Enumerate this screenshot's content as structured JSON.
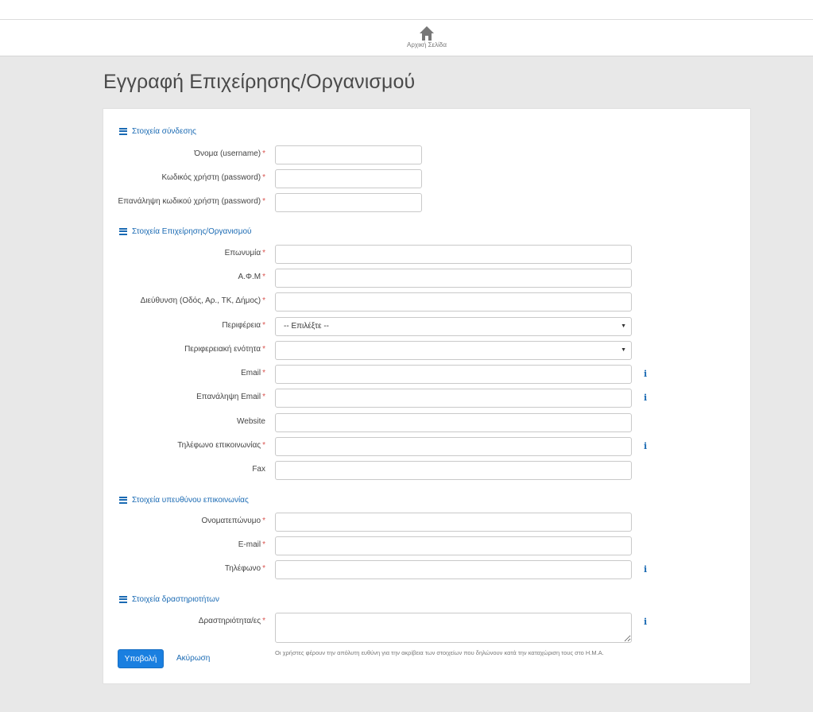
{
  "nav": {
    "home_label": "Αρχική Σελίδα",
    "home_icon": "home-icon"
  },
  "page": {
    "title": "Εγγραφή Επιχείρησης/Οργανισμού"
  },
  "sections": {
    "login": {
      "title": "Στοιχεία σύνδεσης"
    },
    "business": {
      "title": "Στοιχεία Επιχείρησης/Οργανισμού"
    },
    "contact": {
      "title": "Στοιχεία υπευθύνου επικοινωνίας"
    },
    "activities": {
      "title": "Στοιχεία δραστηριοτήτων"
    }
  },
  "fields": {
    "username": {
      "label": "Όνομα (username)",
      "required": "*",
      "value": ""
    },
    "password": {
      "label": "Κωδικός χρήστη (password)",
      "required": "*",
      "value": ""
    },
    "password_repeat": {
      "label": "Επανάληψη κωδικού χρήστη (password)",
      "required": "*",
      "value": ""
    },
    "company_name": {
      "label": "Επωνυμία",
      "required": "*",
      "value": ""
    },
    "afm": {
      "label": "Α.Φ.Μ",
      "required": "*",
      "value": ""
    },
    "address": {
      "label": "Διεύθυνση (Οδός, Αρ., ΤΚ, Δήμος)",
      "required": "*",
      "value": ""
    },
    "region": {
      "label": "Περιφέρεια",
      "required": "*",
      "selected": "-- Επιλέξτε --",
      "caret": "▼"
    },
    "regional_unit": {
      "label": "Περιφερειακή ενότητα",
      "required": "*",
      "selected": "",
      "caret": "▼"
    },
    "email": {
      "label": "Email",
      "required": "*",
      "value": "",
      "info": "i"
    },
    "email_repeat": {
      "label": "Επανάληψη Email",
      "required": "*",
      "value": "",
      "info": "i"
    },
    "website": {
      "label": "Website",
      "value": ""
    },
    "phone": {
      "label": "Τηλέφωνο επικοινωνίας",
      "required": "*",
      "value": "",
      "info": "i"
    },
    "fax": {
      "label": "Fax",
      "value": ""
    },
    "contact_name": {
      "label": "Ονοματεπώνυμο",
      "required": "*",
      "value": ""
    },
    "contact_email": {
      "label": "E-mail",
      "required": "*",
      "value": ""
    },
    "contact_phone": {
      "label": "Τηλέφωνο",
      "required": "*",
      "value": "",
      "info": "i"
    },
    "activities": {
      "label": "Δραστηριότητα/ες",
      "required": "*",
      "value": "",
      "info": "i"
    }
  },
  "actions": {
    "submit_label": "Υποβολή",
    "cancel_label": "Ακύρωση",
    "disclaimer": "Οι χρήστες φέρουν την απόλυτη ευθύνη για την ακρίβεια των στοιχείων που δηλώνουν κατά την καταχώριση τους στο Η.Μ.Α."
  },
  "colors": {
    "accent": "#1a6ab3",
    "button": "#1a7fe0",
    "required": "#d9534f",
    "background": "#e8e8e8"
  }
}
